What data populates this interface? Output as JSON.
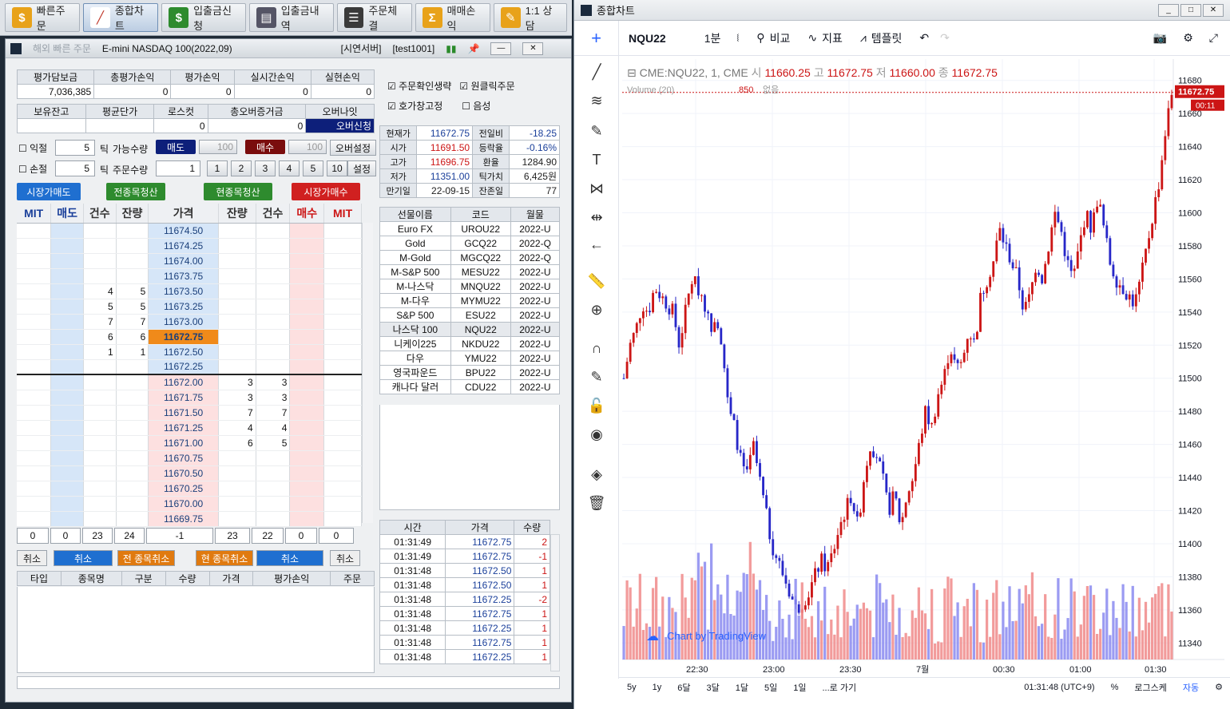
{
  "toolbar": {
    "items": [
      {
        "label": "빠른주문",
        "icon": "coins-icon"
      },
      {
        "label": "종합차트",
        "icon": "chart-icon"
      },
      {
        "label": "입출금신청",
        "icon": "dollar-icon"
      },
      {
        "label": "입출금내역",
        "icon": "document-icon"
      },
      {
        "label": "주문체결",
        "icon": "list-icon"
      },
      {
        "label": "매매손익",
        "icon": "sigma-icon"
      },
      {
        "label": "1:1 상담",
        "icon": "chat-icon"
      }
    ]
  },
  "order_window": {
    "title": "해외 빠른 주문",
    "symbol": "E-mini NASDAQ 100(2022,09)",
    "server": "[시연서버]",
    "account": "[test1001]",
    "summary1": {
      "headers": [
        "평가담보금",
        "총평가손익",
        "평가손익",
        "실시간손익",
        "실현손익"
      ],
      "values": [
        "7,036,385",
        "0",
        "0",
        "0",
        "0"
      ]
    },
    "summary2": {
      "headers": [
        "보유잔고",
        "평균단가",
        "로스컷",
        "총오버증거금",
        "오버나잇"
      ],
      "values": [
        "",
        "",
        "0",
        "0",
        "오버신청"
      ]
    },
    "checks": {
      "confirm": "주문확인생략",
      "oneclick": "원클릭주문",
      "fix": "호가창고정",
      "sound": "음성"
    },
    "takeprofit": {
      "label": "익절",
      "value": "5",
      "unit": "틱",
      "avail": "가능수량",
      "sell": "매도",
      "sell_qty": "100",
      "buy": "매수",
      "buy_qty": "100",
      "set": "오버설정"
    },
    "stoploss": {
      "label": "손절",
      "value": "5",
      "unit": "틱",
      "order_qty": "주문수량",
      "qty": "1",
      "quick": [
        "1",
        "2",
        "3",
        "4",
        "5",
        "10"
      ],
      "set": "설정"
    },
    "action_buttons": [
      "시장가매도",
      "전종목청산",
      "현종목청산",
      "시장가매수"
    ],
    "orderbook": {
      "headers": [
        "MIT",
        "매도",
        "건수",
        "잔량",
        "가격",
        "잔량",
        "건수",
        "매수",
        "MIT"
      ],
      "rows": [
        {
          "price": "11674.50",
          "sc": "",
          "sq": "",
          "bq": "",
          "bc": ""
        },
        {
          "price": "11674.25",
          "sc": "",
          "sq": "",
          "bq": "",
          "bc": ""
        },
        {
          "price": "11674.00",
          "sc": "",
          "sq": "",
          "bq": "",
          "bc": ""
        },
        {
          "price": "11673.75",
          "sc": "",
          "sq": "",
          "bq": "",
          "bc": ""
        },
        {
          "price": "11673.50",
          "sc": "4",
          "sq": "5",
          "bq": "",
          "bc": ""
        },
        {
          "price": "11673.25",
          "sc": "5",
          "sq": "5",
          "bq": "",
          "bc": ""
        },
        {
          "price": "11673.00",
          "sc": "7",
          "sq": "7",
          "bq": "",
          "bc": ""
        },
        {
          "price": "11672.75",
          "sc": "6",
          "sq": "6",
          "bq": "",
          "bc": ""
        },
        {
          "price": "11672.50",
          "sc": "1",
          "sq": "1",
          "bq": "",
          "bc": ""
        },
        {
          "price": "11672.25",
          "sc": "",
          "sq": "",
          "bq": "",
          "bc": ""
        },
        {
          "price": "11672.00",
          "sc": "",
          "sq": "",
          "bq": "3",
          "bc": "3"
        },
        {
          "price": "11671.75",
          "sc": "",
          "sq": "",
          "bq": "3",
          "bc": "3"
        },
        {
          "price": "11671.50",
          "sc": "",
          "sq": "",
          "bq": "7",
          "bc": "7"
        },
        {
          "price": "11671.25",
          "sc": "",
          "sq": "",
          "bq": "4",
          "bc": "4"
        },
        {
          "price": "11671.00",
          "sc": "",
          "sq": "",
          "bq": "6",
          "bc": "5"
        },
        {
          "price": "11670.75",
          "sc": "",
          "sq": "",
          "bq": "",
          "bc": ""
        },
        {
          "price": "11670.50",
          "sc": "",
          "sq": "",
          "bq": "",
          "bc": ""
        },
        {
          "price": "11670.25",
          "sc": "",
          "sq": "",
          "bq": "",
          "bc": ""
        },
        {
          "price": "11670.00",
          "sc": "",
          "sq": "",
          "bq": "",
          "bc": ""
        },
        {
          "price": "11669.75",
          "sc": "",
          "sq": "",
          "bq": "",
          "bc": ""
        }
      ],
      "totals": [
        "0",
        "0",
        "23",
        "24",
        "-1",
        "23",
        "22",
        "0",
        "0"
      ]
    },
    "cancel_buttons": [
      "취소",
      "취소",
      "전 종목취소",
      "현 종목취소",
      "취소",
      "취소"
    ],
    "positions_headers": [
      "타입",
      "종목명",
      "구분",
      "수량",
      "가격",
      "평가손익",
      "주문"
    ],
    "quote": {
      "rows": [
        {
          "l": "현재가",
          "v": "11672.75",
          "l2": "전일비",
          "v2": "-18.25"
        },
        {
          "l": "시가",
          "v": "11691.50",
          "l2": "등락율",
          "v2": "-0.16%"
        },
        {
          "l": "고가",
          "v": "11696.75",
          "l2": "환율",
          "v2": "1284.90"
        },
        {
          "l": "저가",
          "v": "11351.00",
          "l2": "틱가치",
          "v2": "6,425원"
        },
        {
          "l": "만기일",
          "v": "22-09-15",
          "l2": "잔존일",
          "v2": "77"
        }
      ]
    },
    "symbols": {
      "headers": [
        "선물이름",
        "코드",
        "월물"
      ],
      "rows": [
        [
          "Euro FX",
          "UROU22",
          "2022-U"
        ],
        [
          "Gold",
          "GCQ22",
          "2022-Q"
        ],
        [
          "M-Gold",
          "MGCQ22",
          "2022-Q"
        ],
        [
          "M-S&P 500",
          "MESU22",
          "2022-U"
        ],
        [
          "M-나스닥",
          "MNQU22",
          "2022-U"
        ],
        [
          "M-다우",
          "MYMU22",
          "2022-U"
        ],
        [
          "S&P 500",
          "ESU22",
          "2022-U"
        ],
        [
          "나스닥 100",
          "NQU22",
          "2022-U"
        ],
        [
          "니케이225",
          "NKDU22",
          "2022-U"
        ],
        [
          "다우",
          "YMU22",
          "2022-U"
        ],
        [
          "영국파운드",
          "BPU22",
          "2022-U"
        ],
        [
          "캐나다 달러",
          "CDU22",
          "2022-U"
        ]
      ]
    },
    "trades": {
      "headers": [
        "시간",
        "가격",
        "수량"
      ],
      "rows": [
        [
          "01:31:49",
          "11672.75",
          "2"
        ],
        [
          "01:31:49",
          "11672.75",
          "-1"
        ],
        [
          "01:31:48",
          "11672.50",
          "1"
        ],
        [
          "01:31:48",
          "11672.50",
          "1"
        ],
        [
          "01:31:48",
          "11672.25",
          "-2"
        ],
        [
          "01:31:48",
          "11672.75",
          "1"
        ],
        [
          "01:31:48",
          "11672.25",
          "1"
        ],
        [
          "01:31:48",
          "11672.75",
          "1"
        ],
        [
          "01:31:48",
          "11672.25",
          "1"
        ]
      ]
    }
  },
  "chart_window": {
    "title": "종합차트",
    "symbol": "NQU22",
    "interval": "1분",
    "compare": "비교",
    "indicators": "지표",
    "templates": "템플릿",
    "legend": {
      "name": "CME:NQU22, 1, CME",
      "o_label": "시",
      "o": "11660.25",
      "h_label": "고",
      "h": "11672.75",
      "l_label": "저",
      "l": "11660.00",
      "c_label": "종",
      "c": "11672.75"
    },
    "volume_label": "Volume (20)",
    "volume_value": "850",
    "volume_extra": "없음",
    "last_price": "11672.75",
    "countdown": "00:11",
    "watermark": "Chart by TradingView",
    "bottom": {
      "ranges": [
        "5y",
        "1y",
        "6달",
        "3달",
        "1달",
        "5일",
        "1일"
      ],
      "goto": "...로 가기",
      "time": "01:31:48 (UTC+9)",
      "pct": "%",
      "log": "로그스케",
      "auto": "자동"
    }
  },
  "chart_data": {
    "type": "candlestick",
    "y_ticks": [
      11680,
      11660,
      11640,
      11620,
      11600,
      11580,
      11560,
      11540,
      11520,
      11500,
      11480,
      11460,
      11440,
      11420,
      11400,
      11380,
      11360,
      11340
    ],
    "x_ticks": [
      "22:30",
      "23:00",
      "23:30",
      "7월",
      "00:30",
      "01:00",
      "01:30"
    ],
    "ylim": [
      11330,
      11690
    ],
    "colors": {
      "up": "#cc1515",
      "down": "#2727c8",
      "vol_up": "#f08a8a",
      "vol_down": "#8a8af0"
    },
    "path_close": [
      11500,
      11520,
      11530,
      11545,
      11540,
      11555,
      11550,
      11545,
      11540,
      11520,
      11540,
      11560,
      11555,
      11548,
      11530,
      11540,
      11520,
      11480,
      11470,
      11450,
      11440,
      11460,
      11440,
      11420,
      11400,
      11390,
      11380,
      11370,
      11360,
      11365,
      11370,
      11380,
      11390,
      11385,
      11395,
      11410,
      11420,
      11430,
      11410,
      11440,
      11460,
      11455,
      11440,
      11420,
      11430,
      11410,
      11430,
      11440,
      11460,
      11480,
      11470,
      11490,
      11500,
      11520,
      11505,
      11510,
      11530,
      11520,
      11550,
      11560,
      11570,
      11590,
      11580,
      11570,
      11560,
      11540,
      11550,
      11570,
      11560,
      11580,
      11600,
      11590,
      11570,
      11560,
      11580,
      11600,
      11590,
      11610,
      11590,
      11570,
      11560,
      11555,
      11550,
      11545,
      11560,
      11580,
      11600,
      11620,
      11650,
      11672
    ]
  }
}
